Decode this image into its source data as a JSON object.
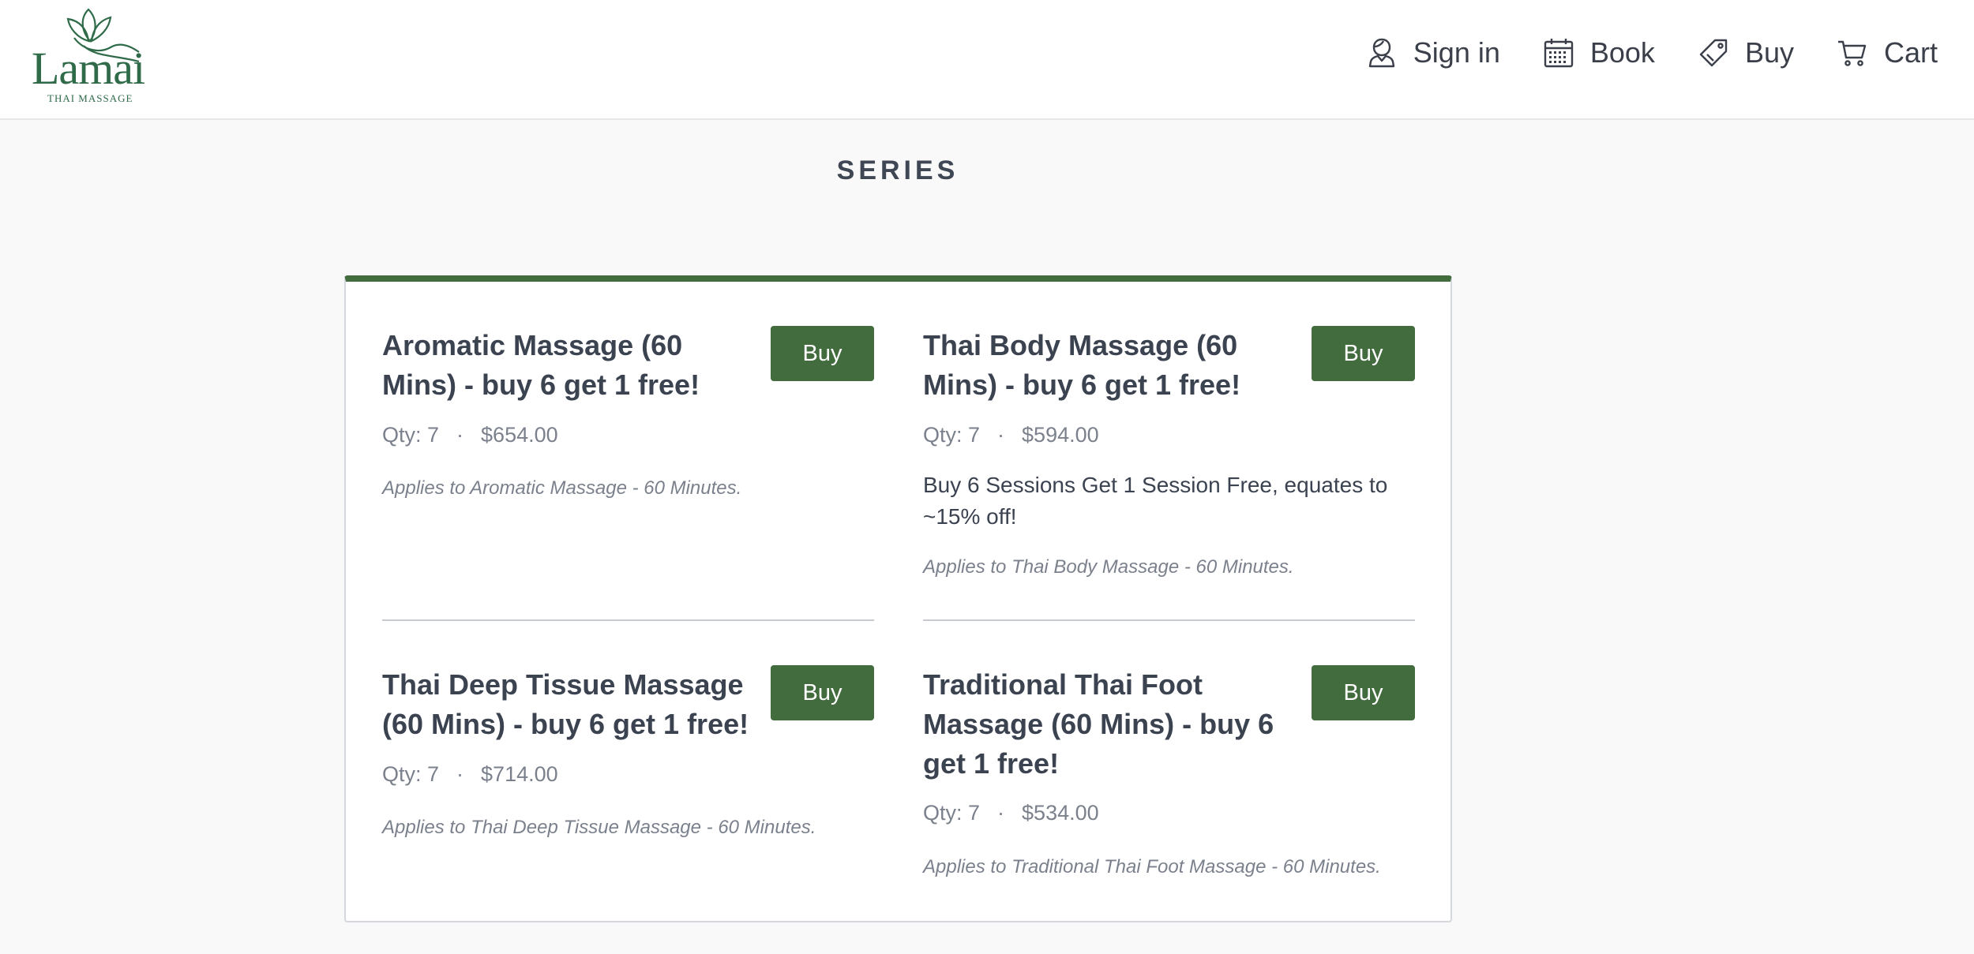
{
  "header": {
    "logo_word": "Lamai",
    "logo_sub": "THAI MASSAGE",
    "nav": [
      {
        "label": "Sign in",
        "icon": "user-icon"
      },
      {
        "label": "Book",
        "icon": "calendar-icon"
      },
      {
        "label": "Buy",
        "icon": "tag-icon"
      },
      {
        "label": "Cart",
        "icon": "cart-icon"
      }
    ]
  },
  "page": {
    "title": "SERIES"
  },
  "series": [
    {
      "title_line1": "Aromatic Massage (60",
      "title_line2": "Mins) - buy 6 get 1 free!",
      "button": "Buy",
      "qty": "Qty: 7",
      "price": "$654.00",
      "description_line1": "",
      "description_line2": "",
      "applies": "Applies to Aromatic Massage - 60 Minutes."
    },
    {
      "title_line1": "Thai Body Massage (60",
      "title_line2": "Mins) - buy 6 get 1 free!",
      "button": "Buy",
      "qty": "Qty: 7",
      "price": "$594.00",
      "description_line1": "Buy 6 Sessions Get 1 Session Free, equates to",
      "description_line2": "~15% off!",
      "applies": "Applies to Thai Body Massage - 60 Minutes."
    },
    {
      "title_line1": "Thai Deep Tissue Massage",
      "title_line2": "(60 Mins) - buy 6 get 1 free!",
      "button": "Buy",
      "qty": "Qty: 7",
      "price": "$714.00",
      "description_line1": "",
      "description_line2": "",
      "applies": "Applies to Thai Deep Tissue Massage - 60 Minutes."
    },
    {
      "title_line1": "Traditional Thai Foot",
      "title_line2": "Massage (60 Mins) - buy 6",
      "title_line3": "get 1 free!",
      "button": "Buy",
      "qty": "Qty: 7",
      "price": "$534.00",
      "description_line1": "",
      "description_line2": "",
      "applies": "Applies to Traditional Thai Foot Massage - 60 Minutes."
    }
  ],
  "separator": "·",
  "colors": {
    "brand_green": "#426b3e",
    "logo_green": "#2f6b49",
    "muted_text": "#7b818c"
  }
}
